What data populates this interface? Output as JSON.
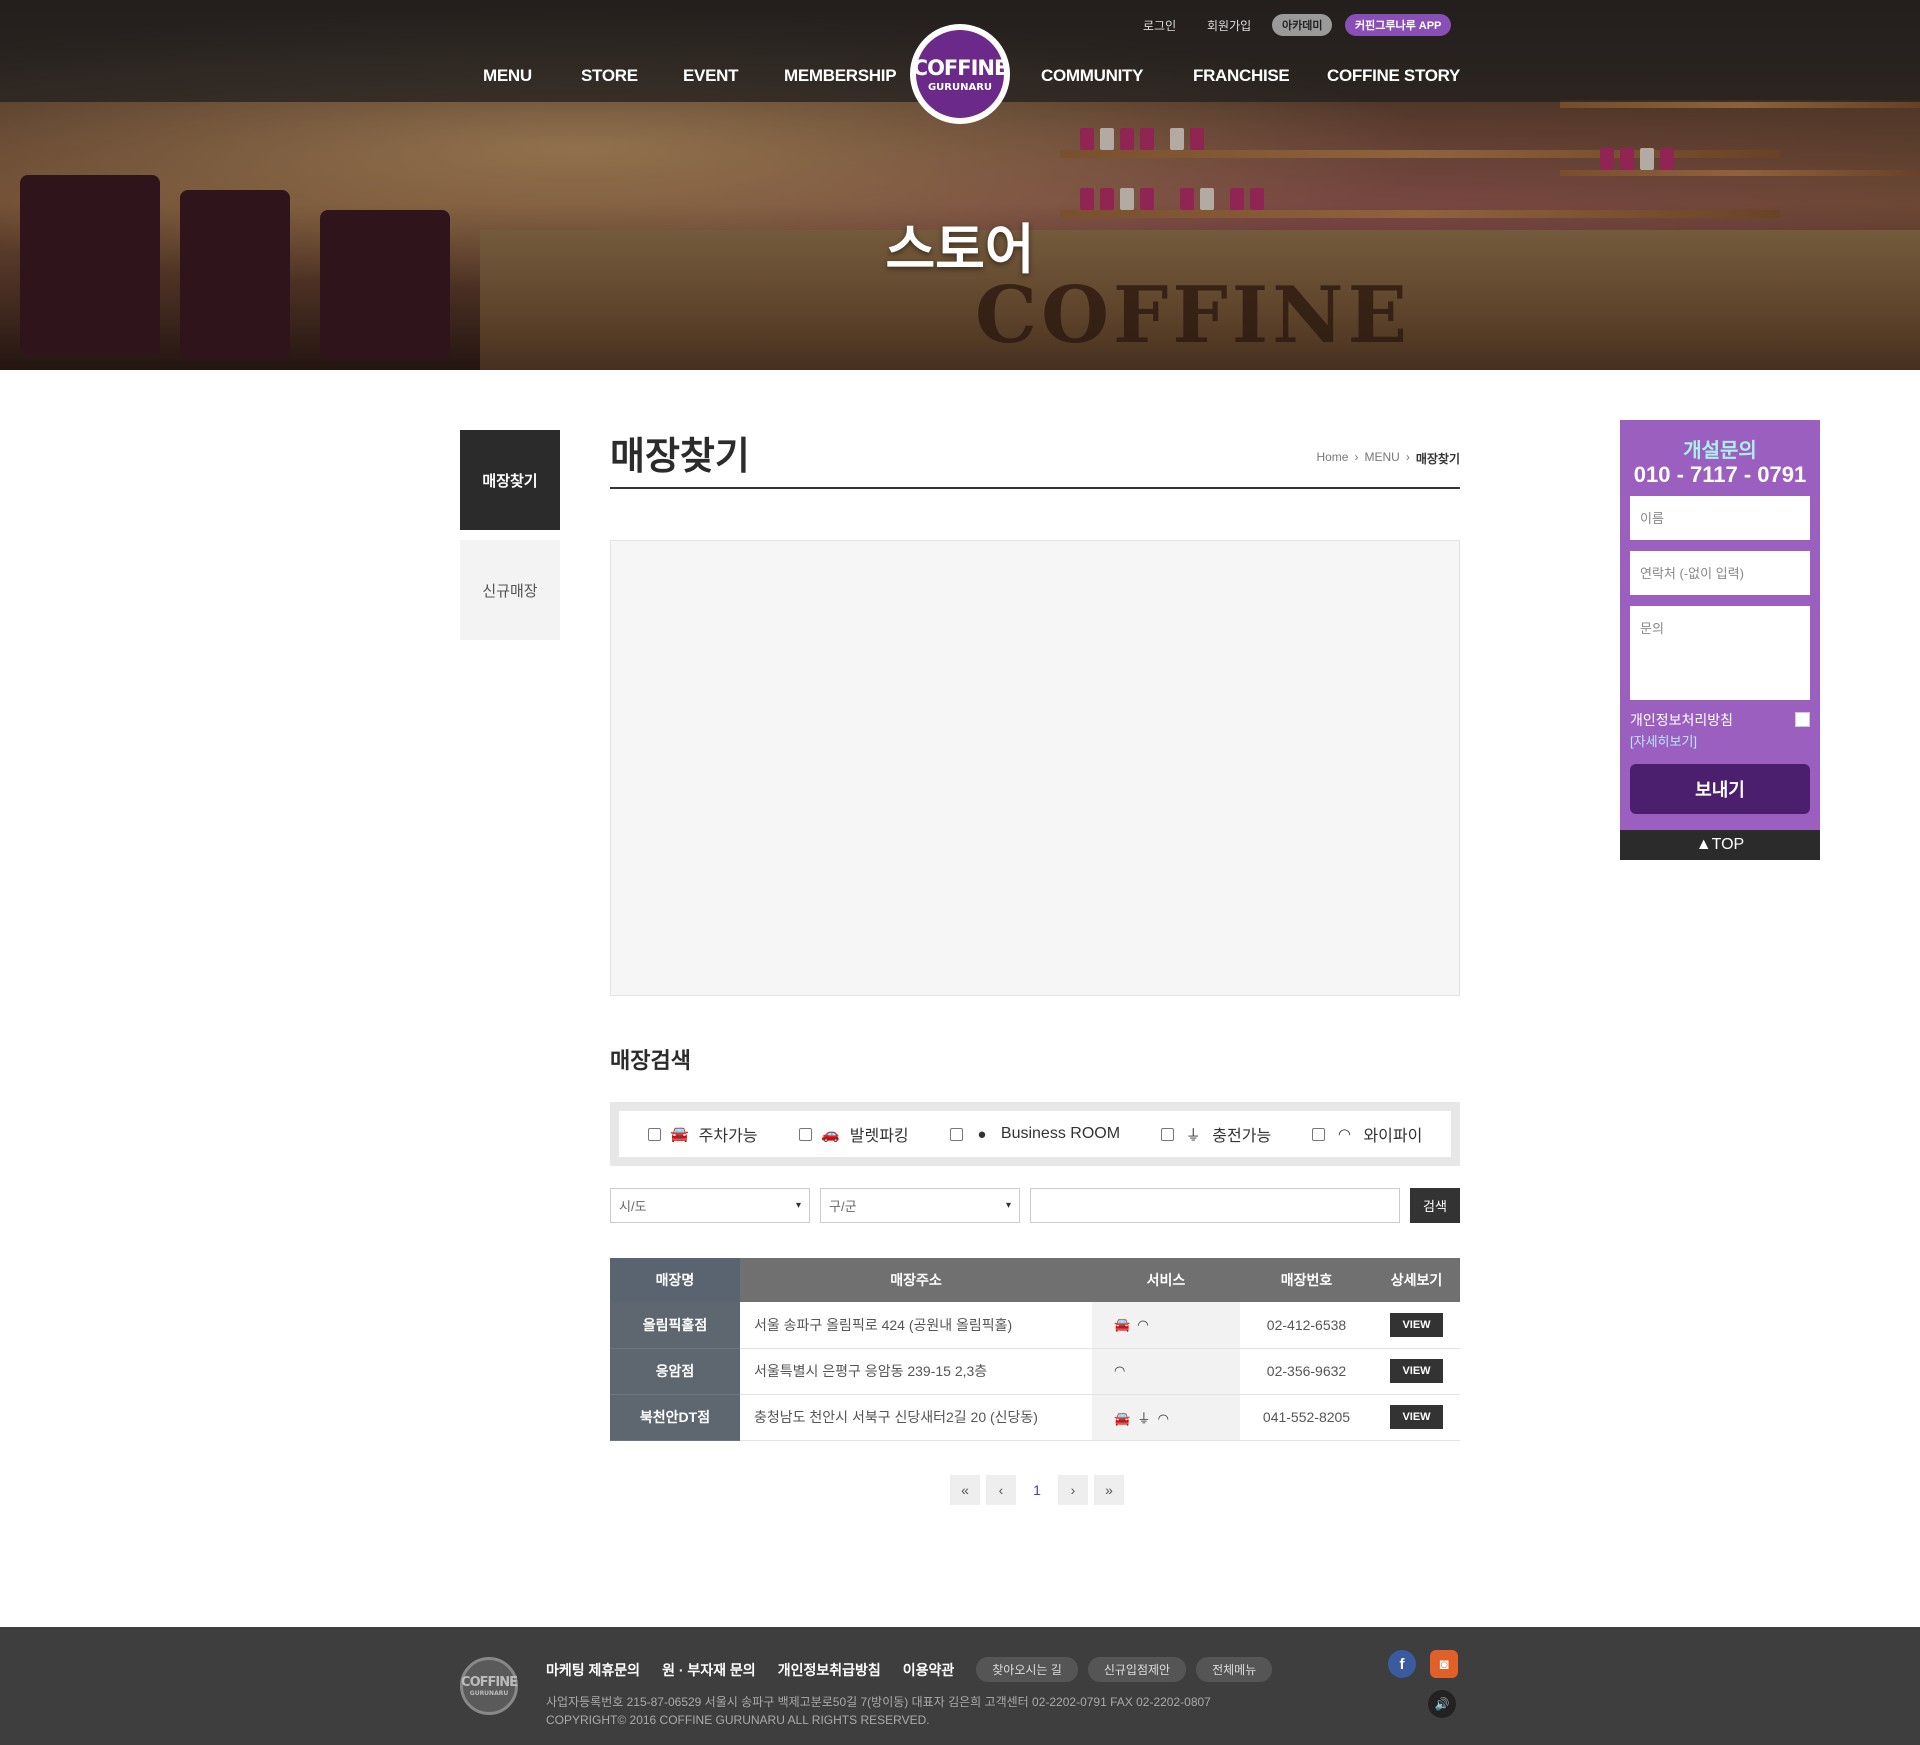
{
  "colors": {
    "brand_purple": "#6b2a8a",
    "inquiry_bg": "#9b5fc0",
    "dark": "#2b2b2b",
    "table_header": "#707070",
    "name_col": "#5e6670"
  },
  "header": {
    "top_links": [
      "로그인",
      "회원가입"
    ],
    "academy_label": "아카데미",
    "app_label": "커핀그루나루 APP",
    "nav_left": [
      "MENU",
      "STORE",
      "EVENT",
      "MEMBERSHIP"
    ],
    "nav_right": [
      "COMMUNITY",
      "FRANCHISE",
      "COFFINE STORY"
    ],
    "logo_line1": "COFFINE",
    "logo_line2": "GURUNARU"
  },
  "hero": {
    "title": "스토어",
    "counter_logo": "COFFINE"
  },
  "subnav": {
    "items": [
      "매장찾기",
      "신규매장"
    ]
  },
  "page": {
    "title": "매장찾기",
    "breadcrumb": [
      "Home",
      "MENU",
      "매장찾기"
    ]
  },
  "search": {
    "section_title": "매장검색",
    "filters": [
      {
        "label": "주차가능",
        "icon": "car-icon"
      },
      {
        "label": "발렛파킹",
        "icon": "valet-icon"
      },
      {
        "label": "Business ROOM",
        "icon": "person-icon"
      },
      {
        "label": "충전가능",
        "icon": "plug-icon"
      },
      {
        "label": "와이파이",
        "icon": "wifi-icon"
      }
    ],
    "city_placeholder": "시/도",
    "district_placeholder": "구/군",
    "button_label": "검색"
  },
  "table": {
    "headers": [
      "매장명",
      "매장주소",
      "서비스",
      "매장번호",
      "상세보기"
    ],
    "rows": [
      {
        "name": "올림픽홀점",
        "address": "서울 송파구 올림픽로 424 (공원내 올림픽홀)",
        "services": [
          "car-icon",
          "wifi-icon"
        ],
        "phone": "02-412-6538",
        "view": "VIEW"
      },
      {
        "name": "응암점",
        "address": "서울특별시 은평구 응암동 239-15 2,3층",
        "services": [
          "wifi-icon"
        ],
        "phone": "02-356-9632",
        "view": "VIEW"
      },
      {
        "name": "북천안DT점",
        "address": "충청남도 천안시 서북구 신당새터2길 20 (신당동)",
        "services": [
          "car-icon",
          "plug-icon",
          "wifi-icon"
        ],
        "phone": "041-552-8205",
        "view": "VIEW"
      }
    ]
  },
  "pagination": {
    "first": "«",
    "prev": "‹",
    "current": "1",
    "next": "›",
    "last": "»"
  },
  "inquiry": {
    "title": "개설문의",
    "phone": "010 - 7117 - 0791",
    "name_placeholder": "이름",
    "contact_placeholder": "연락처 (-없이 입력)",
    "message_placeholder": "문의",
    "privacy_label": "개인정보처리방침",
    "privacy_more": "[자세히보기]",
    "send_label": "보내기",
    "top_label": "▲TOP"
  },
  "footer": {
    "links": [
      "마케팅 제휴문의",
      "원 · 부자재 문의",
      "개인정보취급방침",
      "이용약관"
    ],
    "pills": [
      "찾아오시는 길",
      "신규입점제안",
      "전체메뉴"
    ],
    "info_line1": "사업자등록번호 215-87-06529 서울시 송파구 백제고분로50길 7(방이동) 대표자 김은희    고객센터 02-2202-0791 FAX 02-2202-0807",
    "info_line2": "COPYRIGHT© 2016 COFFINE GURUNARU ALL RIGHTS RESERVED.",
    "logo_line1": "COFFINE",
    "logo_line2": "GURUNARU",
    "facebook": "f",
    "instagram": "◙",
    "sound": "🔊"
  }
}
